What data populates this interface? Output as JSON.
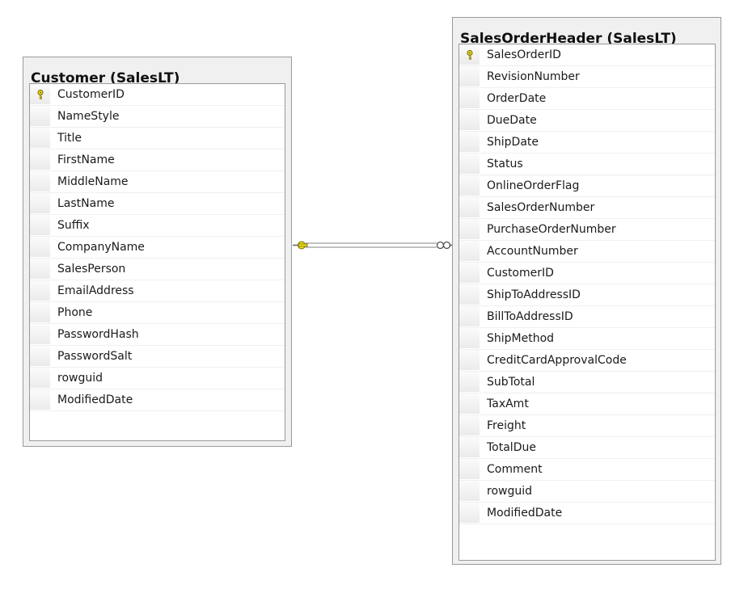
{
  "colors": {
    "table_bg": "#f0f0f0",
    "border": "#9a9a9a",
    "key": "#f2e320",
    "line": "#808080"
  },
  "tables": {
    "customer": {
      "title": "Customer (SalesLT)",
      "columns": [
        {
          "name": "CustomerID",
          "primary_key": true
        },
        {
          "name": "NameStyle",
          "primary_key": false
        },
        {
          "name": "Title",
          "primary_key": false
        },
        {
          "name": "FirstName",
          "primary_key": false
        },
        {
          "name": "MiddleName",
          "primary_key": false
        },
        {
          "name": "LastName",
          "primary_key": false
        },
        {
          "name": "Suffix",
          "primary_key": false
        },
        {
          "name": "CompanyName",
          "primary_key": false
        },
        {
          "name": "SalesPerson",
          "primary_key": false
        },
        {
          "name": "EmailAddress",
          "primary_key": false
        },
        {
          "name": "Phone",
          "primary_key": false
        },
        {
          "name": "PasswordHash",
          "primary_key": false
        },
        {
          "name": "PasswordSalt",
          "primary_key": false
        },
        {
          "name": "rowguid",
          "primary_key": false
        },
        {
          "name": "ModifiedDate",
          "primary_key": false
        }
      ]
    },
    "sales_order_header": {
      "title": "SalesOrderHeader (SalesLT)",
      "columns": [
        {
          "name": "SalesOrderID",
          "primary_key": true
        },
        {
          "name": "RevisionNumber",
          "primary_key": false
        },
        {
          "name": "OrderDate",
          "primary_key": false
        },
        {
          "name": "DueDate",
          "primary_key": false
        },
        {
          "name": "ShipDate",
          "primary_key": false
        },
        {
          "name": "Status",
          "primary_key": false
        },
        {
          "name": "OnlineOrderFlag",
          "primary_key": false
        },
        {
          "name": "SalesOrderNumber",
          "primary_key": false
        },
        {
          "name": "PurchaseOrderNumber",
          "primary_key": false
        },
        {
          "name": "AccountNumber",
          "primary_key": false
        },
        {
          "name": "CustomerID",
          "primary_key": false
        },
        {
          "name": "ShipToAddressID",
          "primary_key": false
        },
        {
          "name": "BillToAddressID",
          "primary_key": false
        },
        {
          "name": "ShipMethod",
          "primary_key": false
        },
        {
          "name": "CreditCardApprovalCode",
          "primary_key": false
        },
        {
          "name": "SubTotal",
          "primary_key": false
        },
        {
          "name": "TaxAmt",
          "primary_key": false
        },
        {
          "name": "Freight",
          "primary_key": false
        },
        {
          "name": "TotalDue",
          "primary_key": false
        },
        {
          "name": "Comment",
          "primary_key": false
        },
        {
          "name": "rowguid",
          "primary_key": false
        },
        {
          "name": "ModifiedDate",
          "primary_key": false
        }
      ]
    }
  },
  "relationship": {
    "from_table": "customer",
    "to_table": "sales_order_header",
    "from_end": "one-key",
    "to_end": "many-infinity"
  }
}
